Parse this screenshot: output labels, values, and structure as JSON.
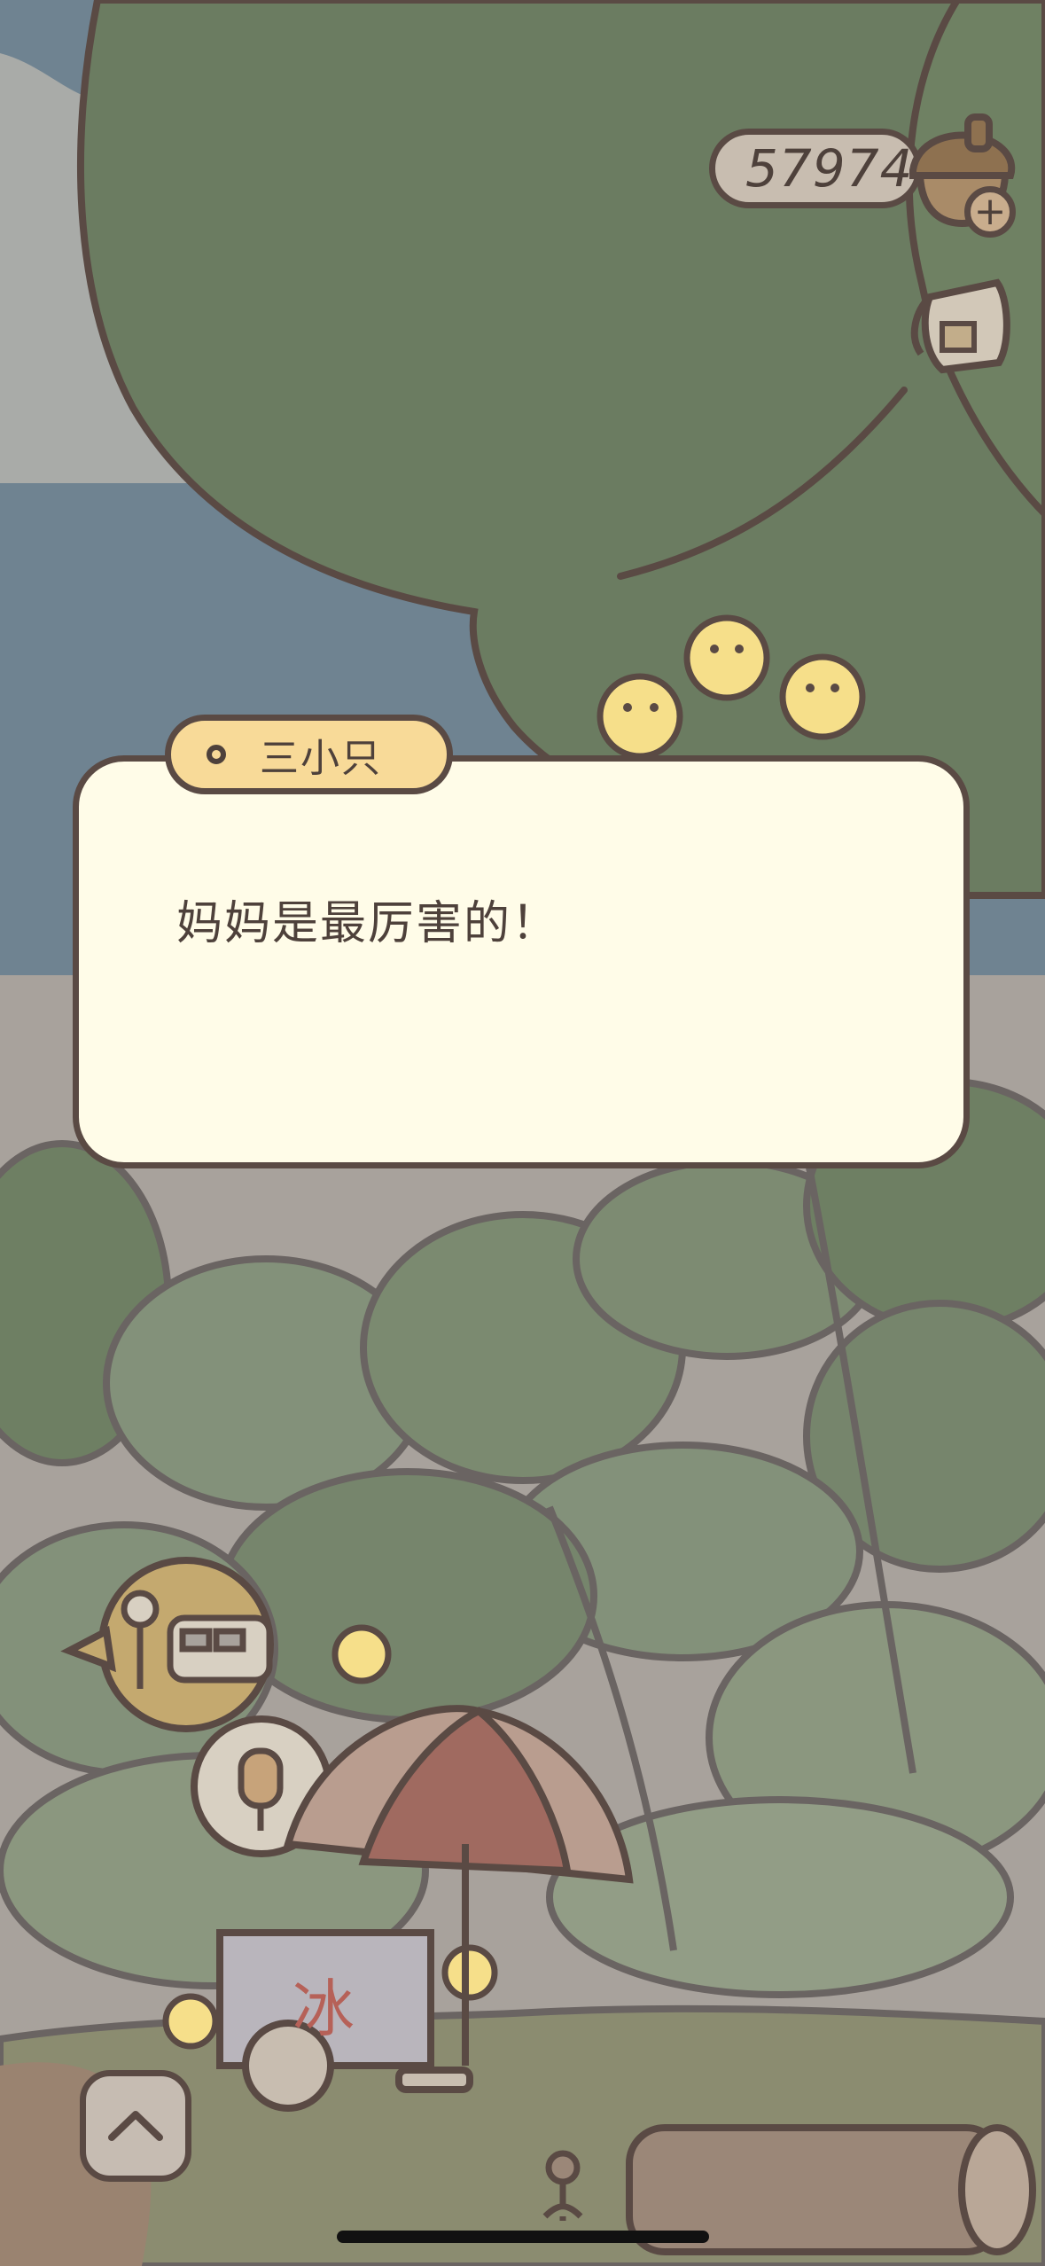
{
  "hud": {
    "acorn_count": "57974",
    "icons": [
      "acorn-icon",
      "plus-icon",
      "bag-icon"
    ]
  },
  "dialog": {
    "speaker": "三小只",
    "text": "妈妈是最厉害的！"
  },
  "scene": {
    "sign_icons": [
      "bus-stop-icon",
      "ice-cream-icon"
    ],
    "cart_label": "冰"
  },
  "controls": {
    "up_icon": "chevron-up-icon"
  },
  "colors": {
    "sky": "#6f8391",
    "tree": "#6b7c61",
    "dialog_bg": "#fffce8",
    "speaker_tab": "#f8da98",
    "outline": "#5a4a44"
  }
}
